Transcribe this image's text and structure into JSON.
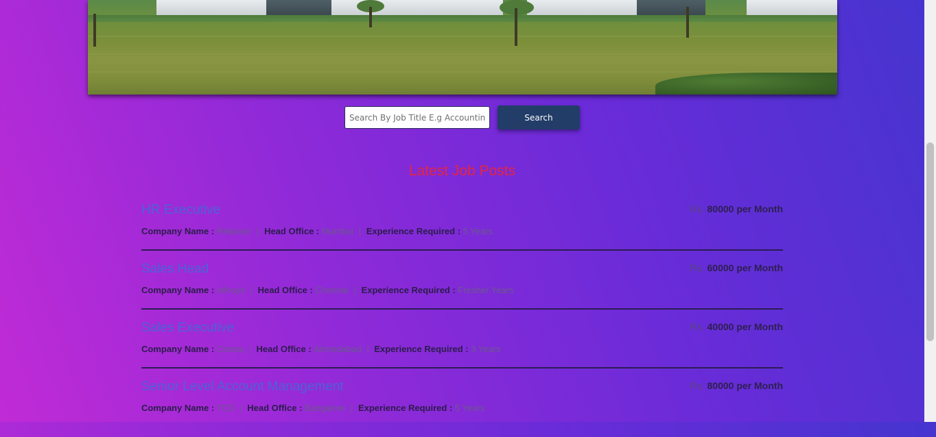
{
  "search": {
    "placeholder": "Search By Job Title E.g Accounting",
    "button_label": "Search"
  },
  "section": {
    "title": "Latest Job Posts"
  },
  "labels": {
    "company": "Company Name :",
    "head_office": "Head Office :",
    "experience": "Experience Required :",
    "separator": "|",
    "currency": "Rs."
  },
  "jobs": [
    {
      "title": "HR Executive",
      "salary": "80000 per Month",
      "company": "Reliance",
      "head_office": "Mumbai",
      "experience": "5 Years"
    },
    {
      "title": "Sales Head",
      "salary": "60000 per Month",
      "company": "Infosys",
      "head_office": "Chennai",
      "experience": "Fresher Years"
    },
    {
      "title": "Sales Executive",
      "salary": "40000 per Month",
      "company": "Croma",
      "head_office": "Ahmedabad",
      "experience": "3 Years"
    },
    {
      "title": "Senior Level Account Management",
      "salary": "80000 per Month",
      "company": "TCS",
      "head_office": "Bangalore",
      "experience": "5 Years"
    }
  ],
  "colors": {
    "section_title": "#e3263f",
    "job_title": "#4b63d6",
    "search_button": "#223d68"
  }
}
